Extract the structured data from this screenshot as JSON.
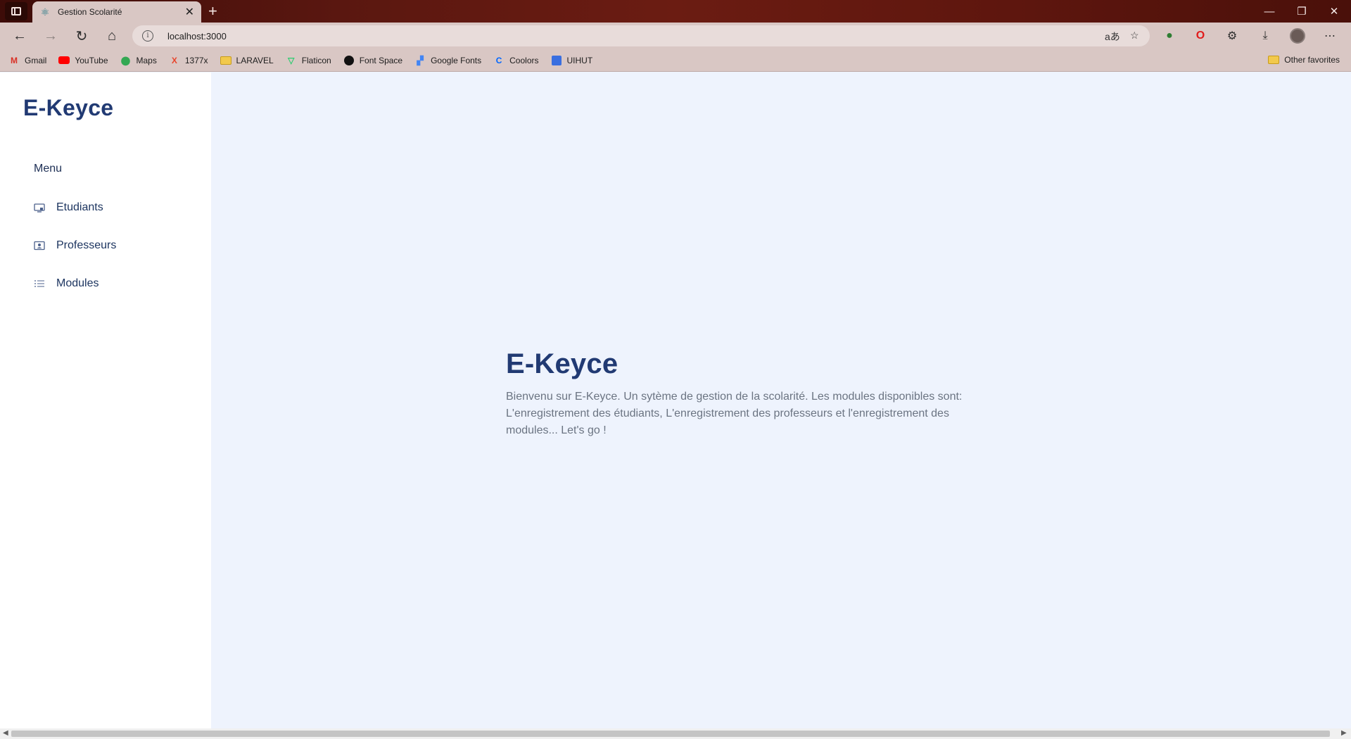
{
  "browser": {
    "tab_title": "Gestion Scolarité",
    "tab_close": "✕",
    "new_tab": "+",
    "url": "localhost:3000",
    "bookmarks": [
      {
        "label": "Gmail",
        "icon": "gmail-icon"
      },
      {
        "label": "YouTube",
        "icon": "youtube-icon"
      },
      {
        "label": "Maps",
        "icon": "maps-icon"
      },
      {
        "label": "1377x",
        "icon": "1377x-icon"
      },
      {
        "label": "LARAVEL",
        "icon": "folder-icon"
      },
      {
        "label": "Flaticon",
        "icon": "flaticon-icon"
      },
      {
        "label": "Font Space",
        "icon": "fontspace-icon"
      },
      {
        "label": "Google Fonts",
        "icon": "google-fonts-icon"
      },
      {
        "label": "Coolors",
        "icon": "coolors-icon"
      },
      {
        "label": "UIHUT",
        "icon": "uihut-icon"
      }
    ],
    "other_favorites": "Other favorites"
  },
  "sidebar": {
    "brand": "E-Keyce",
    "menu_label": "Menu",
    "items": [
      {
        "label": "Etudiants",
        "icon": "student-screen-icon"
      },
      {
        "label": "Professeurs",
        "icon": "teacher-id-card-icon"
      },
      {
        "label": "Modules",
        "icon": "list-icon"
      }
    ]
  },
  "main": {
    "title": "E-Keyce",
    "description": "Bienvenu sur E-Keyce. Un sytème de gestion de la scolarité. Les modules disponibles sont: L'enregistrement des étudiants, L'enregistrement des professeurs et l'enregistrement des modules... Let's go !"
  },
  "colors": {
    "brand": "#213a73",
    "main_bg": "#eef3fd",
    "sidebar_bg": "#ffffff",
    "body_text": "#6b7482"
  }
}
